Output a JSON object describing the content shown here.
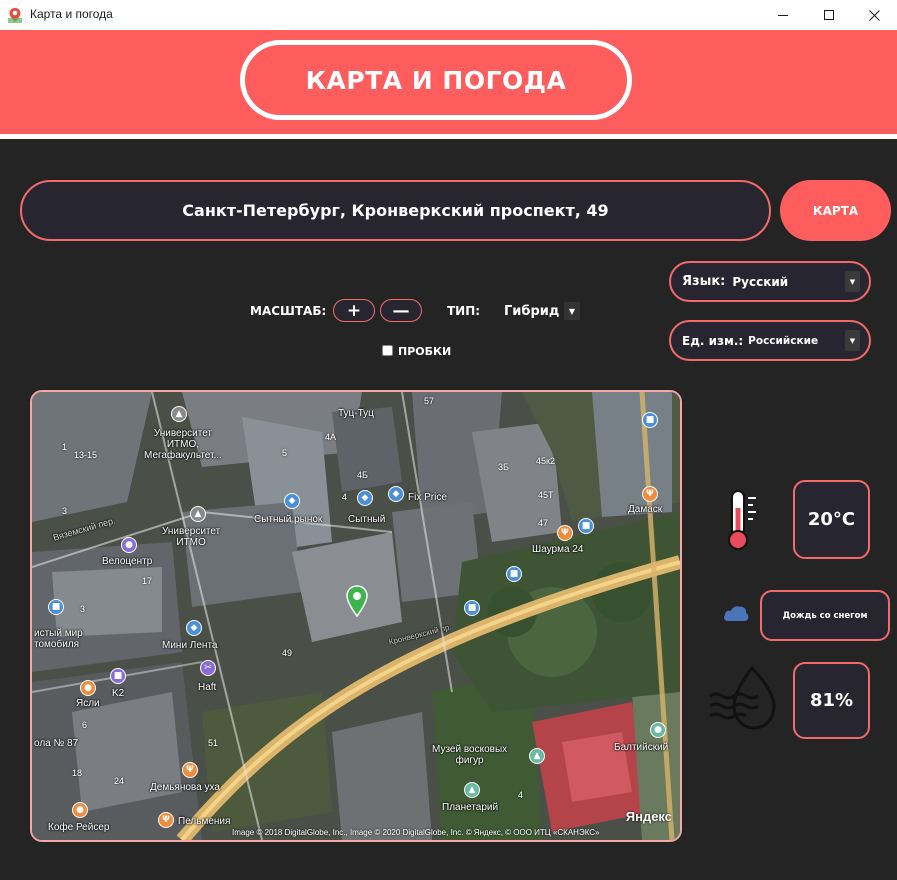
{
  "window": {
    "title": "Карта и погода"
  },
  "header": {
    "title": "КАРТА И ПОГОДА"
  },
  "address": {
    "value": "Санкт-Петербург, Кронверкский проспект, 49"
  },
  "map_button": {
    "label": "КАРТА"
  },
  "controls": {
    "zoom_label": "МАСШТАБ:",
    "zoom_in": "+",
    "zoom_out": "—",
    "type_label": "ТИП:",
    "type_value": "Гибрид",
    "traffic_label": "ПРОБКИ",
    "traffic_checked": false
  },
  "language": {
    "label": "Язык:",
    "value": "Русский"
  },
  "units": {
    "label": "Ед. изм.:",
    "value": "Российские"
  },
  "map": {
    "labels": {
      "univ1": "Университет\nИТМО,\nМегафакультет...",
      "tuc": "Туц-Туц",
      "fix": "Fix Price",
      "market": "Сытный рынок",
      "sytny": "Сытный",
      "univ2": "Университет\nИТМО",
      "velo": "Велоцентр",
      "street1": "Вяземский пер.",
      "mini": "Мини Лента",
      "haft": "Haft",
      "k2": "K2",
      "yasli": "Ясли",
      "clean": "истый мир\nтомобиля",
      "school": "ола № 87",
      "demyan": "Демьянова уха",
      "pelm": "Пельмения",
      "kofe": "Кофе Рейсер",
      "museum": "Музей восковых\nфигур",
      "plan": "Планетарий",
      "baltic": "Балтийский",
      "shaurma": "Шаурма 24",
      "damask": "Дамаск",
      "street2": "Кронверкский пр."
    },
    "numbers": [
      "1",
      "13-15",
      "3",
      "5",
      "4А",
      "4Б",
      "4",
      "17",
      "3",
      "49",
      "6",
      "18",
      "24",
      "51",
      "3Б",
      "45к2",
      "45Т",
      "47",
      "4",
      "57"
    ],
    "yandex": "Яндекс",
    "copyright": "Image © 2018 DigitalGlobe, Inc., Image © 2020 DigitalGlobe, Inc. © Яндекс, © ООО ИТЦ «СКАНЭКС»"
  },
  "weather": {
    "temperature": "20°C",
    "condition": "Дождь со снегом",
    "humidity": "81%"
  },
  "colors": {
    "accent": "#fe5d5e",
    "border": "#f26b6b",
    "background": "#242424",
    "panel": "#272630"
  }
}
